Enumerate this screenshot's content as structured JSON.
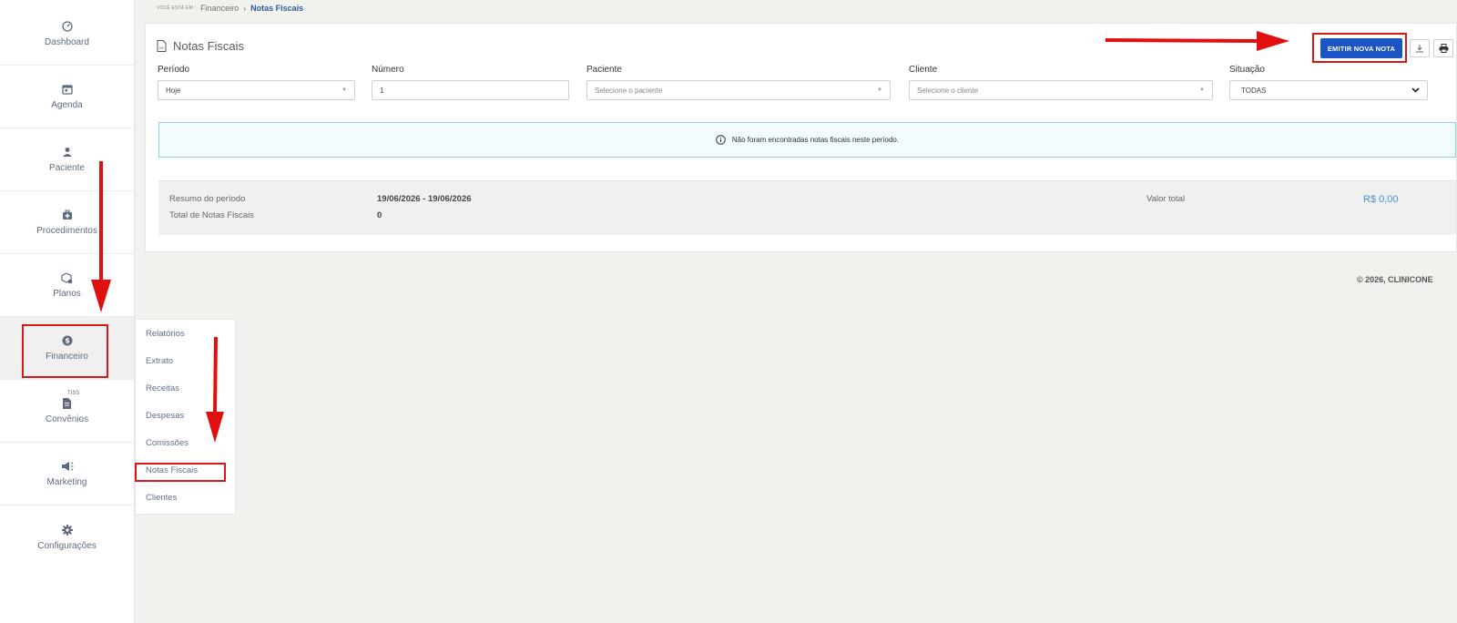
{
  "sidebar": {
    "items": [
      {
        "label": "Dashboard",
        "icon": "gauge-icon"
      },
      {
        "label": "Agenda",
        "icon": "calendar-icon"
      },
      {
        "label": "Paciente",
        "icon": "user-icon"
      },
      {
        "label": "Procedimentos",
        "icon": "medical-bag-icon"
      },
      {
        "label": "Planos",
        "icon": "cube-icon"
      },
      {
        "label": "Financeiro",
        "icon": "dollar-circle-icon"
      },
      {
        "label": "Convênios",
        "icon": "document-icon",
        "badge": "TISS"
      },
      {
        "label": "Marketing",
        "icon": "megaphone-icon"
      },
      {
        "label": "Configurações",
        "icon": "gear-icon"
      }
    ]
  },
  "submenu": {
    "items": [
      {
        "label": "Relatórios"
      },
      {
        "label": "Extrato"
      },
      {
        "label": "Receitas"
      },
      {
        "label": "Despesas"
      },
      {
        "label": "Comissões"
      },
      {
        "label": "Notas Fiscais"
      },
      {
        "label": "Clientes"
      }
    ]
  },
  "breadcrumb": {
    "prefix": "VOCÊ ESTÁ EM :",
    "section": "Financeiro",
    "separator": "›",
    "current": "Notas Fiscais"
  },
  "page": {
    "title": "Notas Fiscais",
    "emit_button": "EMITIR NOVA NOTA"
  },
  "filters": {
    "periodo": {
      "label": "Período",
      "value": "Hoje"
    },
    "numero": {
      "label": "Número",
      "value": "1"
    },
    "paciente": {
      "label": "Paciente",
      "placeholder": "Selecione o paciente"
    },
    "cliente": {
      "label": "Cliente",
      "placeholder": "Selecione o cliente"
    },
    "situacao": {
      "label": "Situação",
      "value": "TODAS"
    }
  },
  "alert": {
    "message": "Não foram encontradas notas fiscais neste período."
  },
  "summary": {
    "periodo_label": "Resumo do período",
    "periodo_value": "19/06/2026 - 19/06/2026",
    "total_label": "Total de Notas Fiscais",
    "total_value": "0",
    "valor_label": "Valor total",
    "valor_value": "R$ 0,00"
  },
  "footer": {
    "text": "© 2026, CLINICONE"
  },
  "colors": {
    "primary": "#1b55c4",
    "annotation": "#d81818",
    "link": "#2a5d9a",
    "alert_border": "#8fd0de"
  }
}
